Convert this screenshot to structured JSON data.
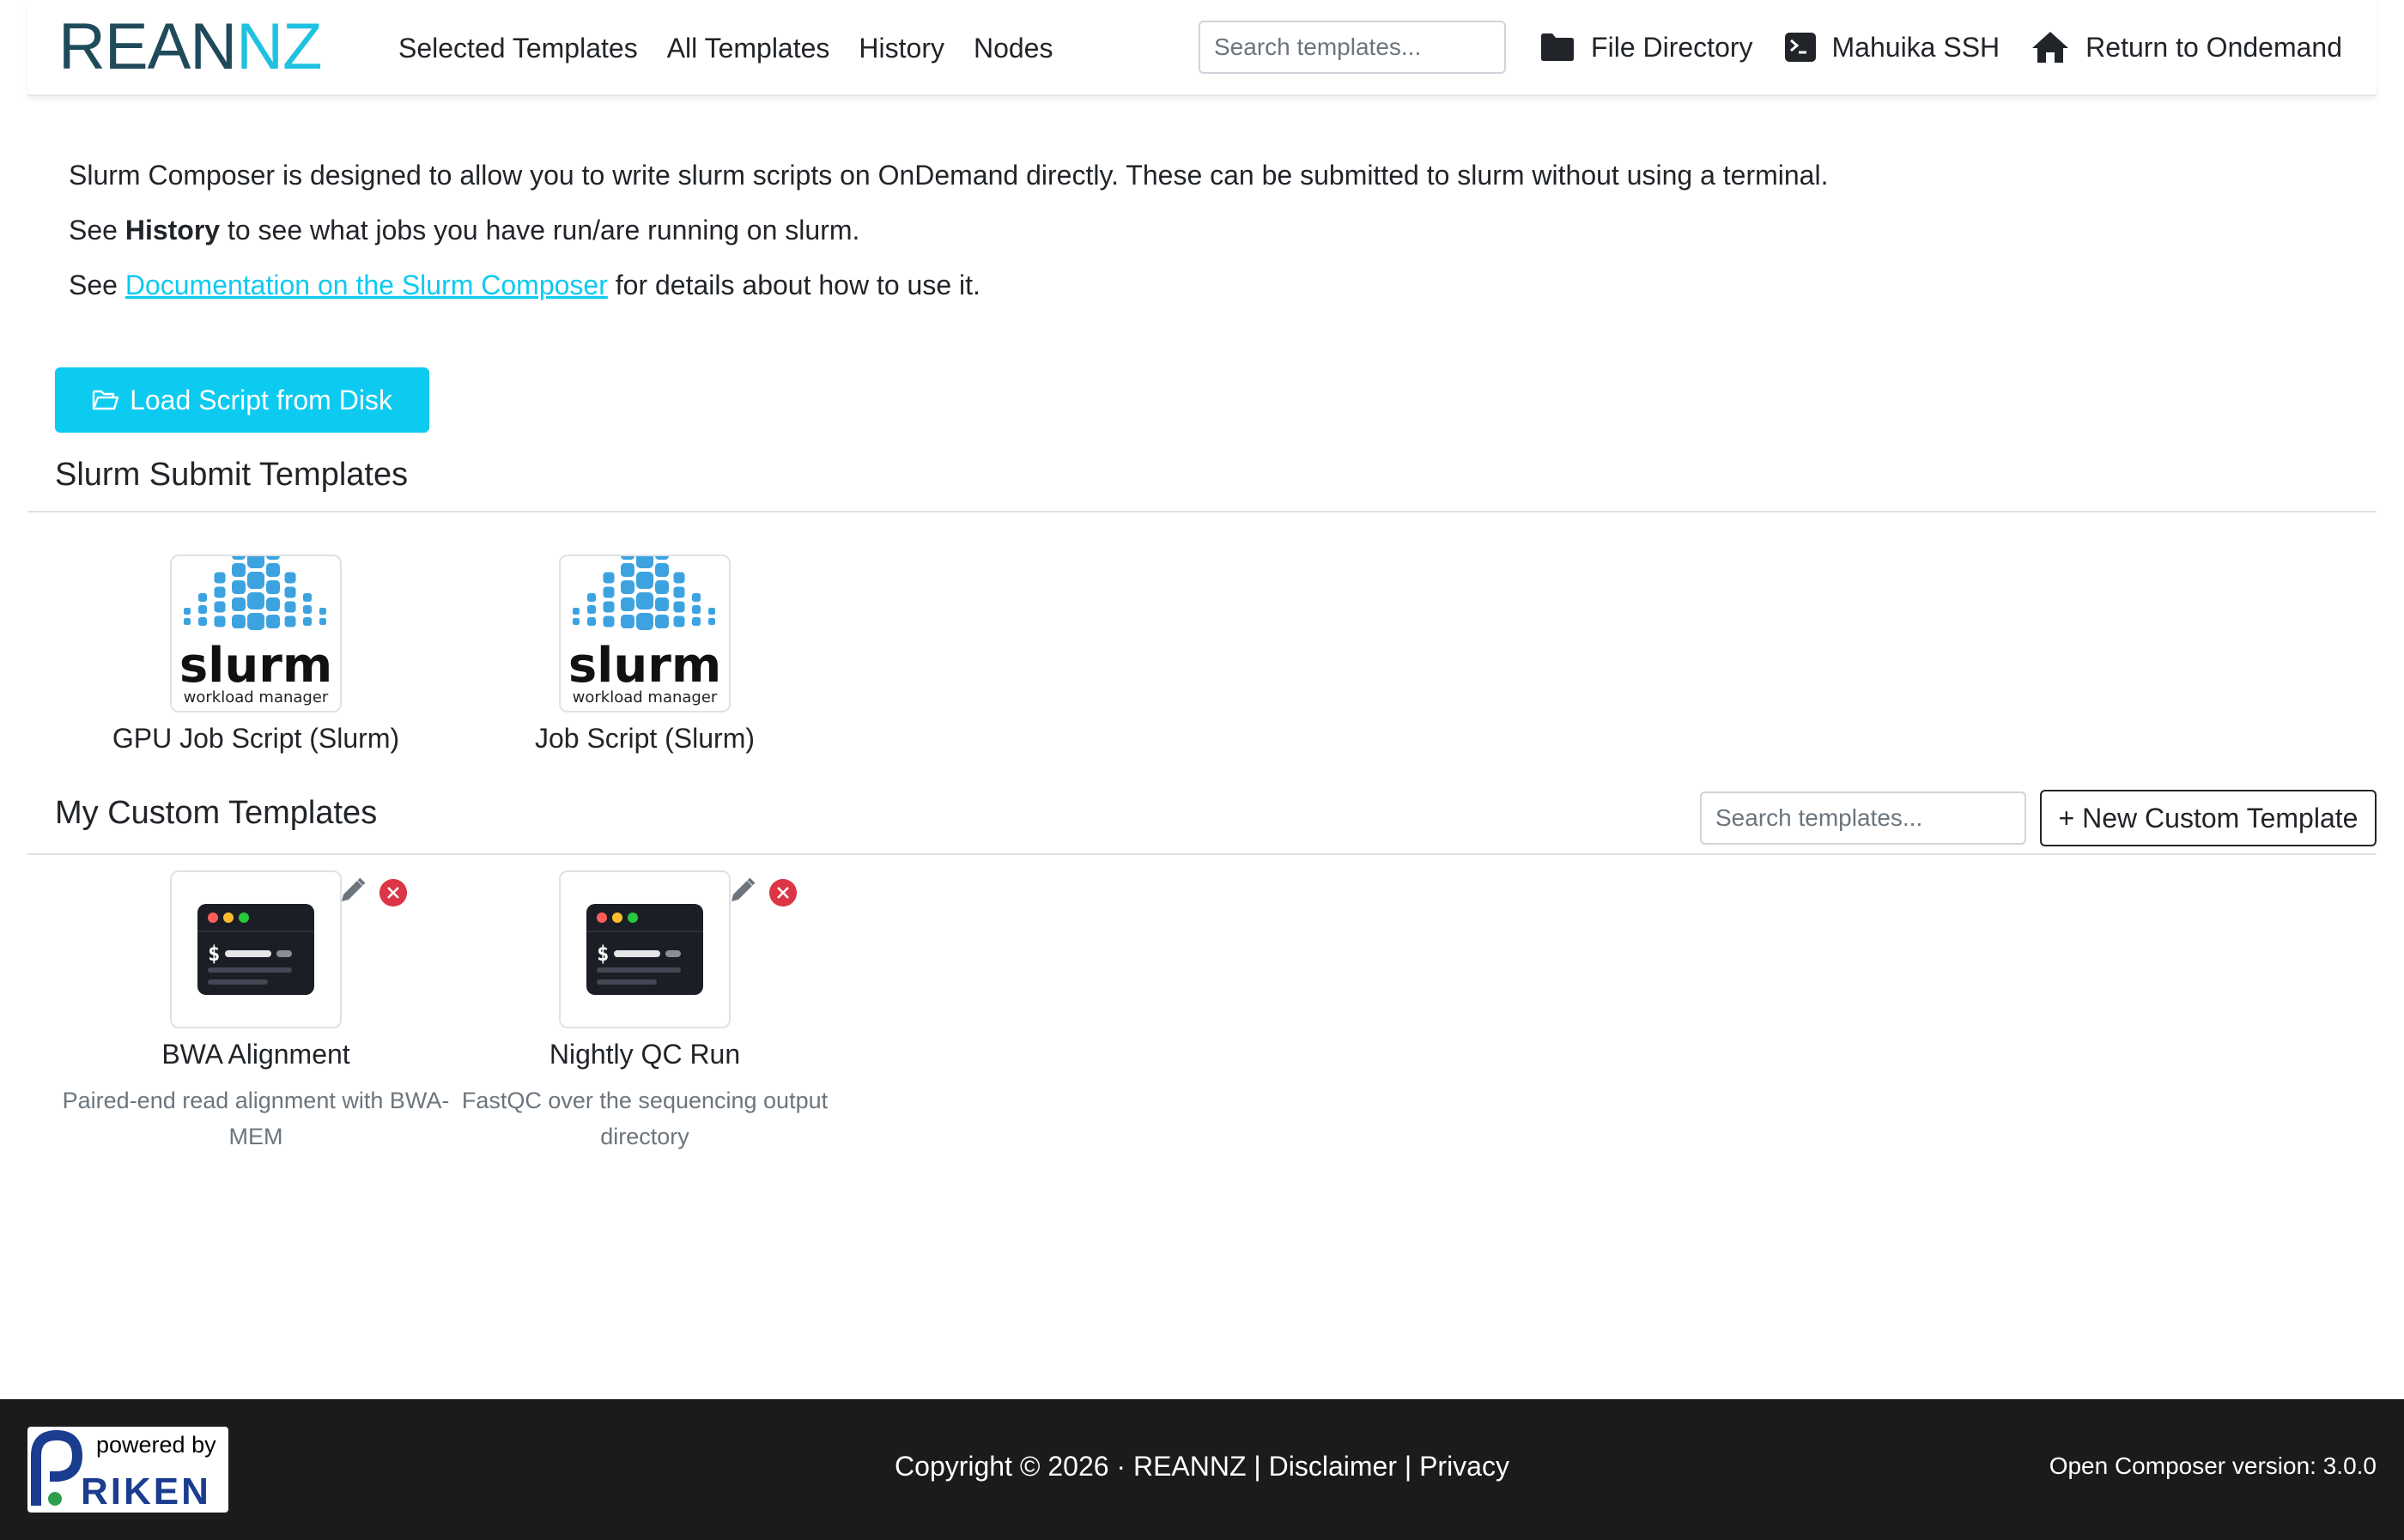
{
  "brand": {
    "name": "REANNZ",
    "colors": {
      "dark": "#1f4a5a",
      "accent": "#1fc1e0"
    }
  },
  "nav": {
    "links": [
      "Selected Templates",
      "All Templates",
      "History",
      "Nodes"
    ],
    "search_placeholder": "Search templates...",
    "actions": [
      {
        "label": "File Directory",
        "icon": "folder-icon"
      },
      {
        "label": "Mahuika SSH",
        "icon": "terminal-icon"
      },
      {
        "label": "Return to Ondemand",
        "icon": "home-icon"
      }
    ]
  },
  "intro": {
    "line1": "Slurm Composer is designed to allow you to write slurm scripts on OnDemand directly. These can be submitted to slurm without using a terminal.",
    "line2_pre": "See ",
    "line2_bold": "History",
    "line2_post": " to see what jobs you have run/are running on slurm.",
    "line3_pre": "See ",
    "line3_link": "Documentation on the Slurm Composer",
    "line3_post": " for details about how to use it."
  },
  "load_button": {
    "label": "Load Script from Disk",
    "icon": "folder-open-icon"
  },
  "slurm_section": {
    "title": "Slurm Submit Templates",
    "logo_word": "slurm",
    "logo_sub": "workload manager",
    "templates": [
      {
        "title": "GPU Job Script (Slurm)"
      },
      {
        "title": "Job Script (Slurm)"
      }
    ]
  },
  "custom_section": {
    "title": "My Custom Templates",
    "search_placeholder": "Search templates...",
    "new_button": "+ New Custom Template",
    "templates": [
      {
        "title": "BWA Alignment",
        "description": "Paired-end read alignment with BWA-MEM"
      },
      {
        "title": "Nightly QC Run",
        "description": "FastQC over the sequencing output directory"
      }
    ]
  },
  "footer": {
    "powered_by": "powered by",
    "riken": "RIKEN",
    "copyright": "Copyright © 2026 · REANNZ",
    "sep": " | ",
    "disclaimer": "Disclaimer",
    "privacy": "Privacy",
    "version": "Open Composer version: 3.0.0"
  },
  "colors": {
    "info": "#0dcaf0",
    "danger": "#dc3545",
    "footer_bg": "#1b1b1b",
    "slurm_blue": "#3da3e0"
  }
}
